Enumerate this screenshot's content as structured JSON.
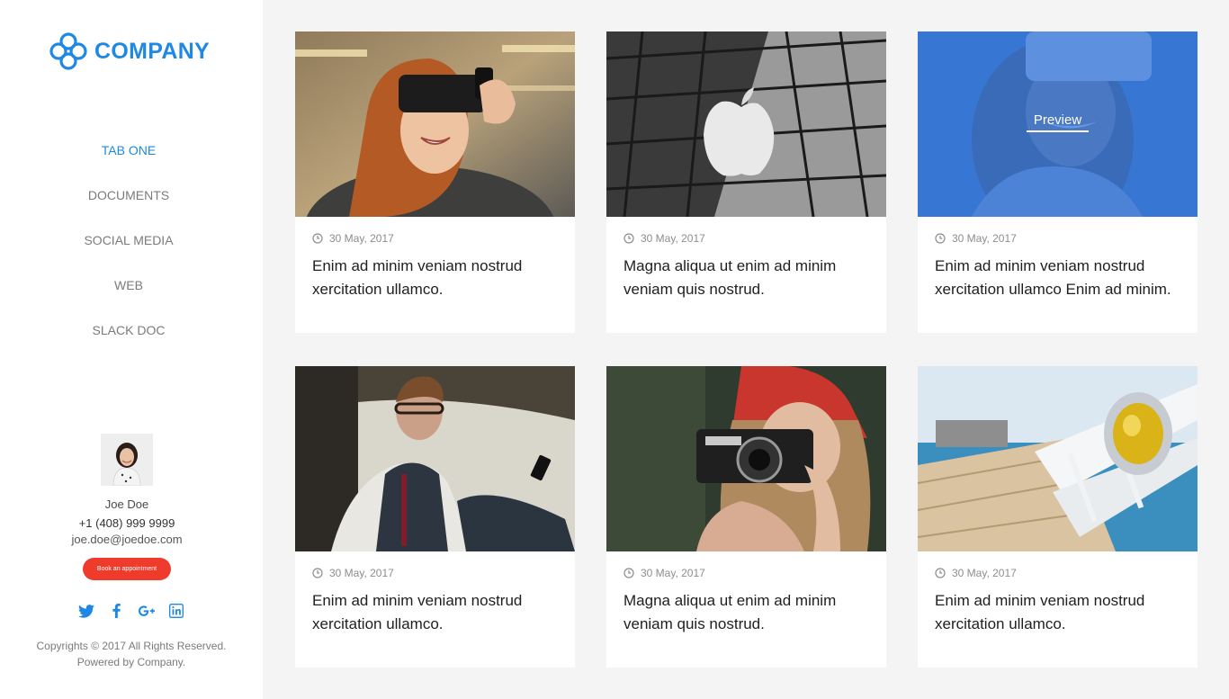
{
  "brand": {
    "name": "COMPANY",
    "color": "#1e88e5"
  },
  "nav": {
    "items": [
      {
        "label": "TAB ONE",
        "active": true
      },
      {
        "label": "DOCUMENTS",
        "active": false
      },
      {
        "label": "SOCIAL MEDIA",
        "active": false
      },
      {
        "label": "WEB",
        "active": false
      },
      {
        "label": "SLACK DOC",
        "active": false
      }
    ]
  },
  "profile": {
    "name": "Joe Doe",
    "phone": "+1 (408) 999 9999",
    "email": "joe.doe@joedoe.com",
    "button_label": "Book an appointment",
    "button_color": "#ef3b2c"
  },
  "social": [
    "twitter-icon",
    "facebook-icon",
    "google-plus-icon",
    "linkedin-icon"
  ],
  "footer": {
    "line1": "Copyrights © 2017 All Rights Reserved.",
    "line2": "Powered by Company."
  },
  "cards": [
    {
      "date": "30 May, 2017",
      "title": "Enim ad minim veniam nostrud xercitation ullamco.",
      "image": "woman-vr-headset"
    },
    {
      "date": "30 May, 2017",
      "title": "Magna aliqua ut enim ad minim veniam quis nostrud.",
      "image": "apple-store-glass"
    },
    {
      "date": "30 May, 2017",
      "title": "Enim ad minim veniam nostrud xercitation ullamco Enim ad minim.",
      "image": "woman-vr-blue",
      "overlay_label": "Preview"
    },
    {
      "date": "30 May, 2017",
      "title": "Enim ad minim veniam nostrud xercitation ullamco.",
      "image": "man-phone-couch"
    },
    {
      "date": "30 May, 2017",
      "title": "Magna aliqua ut enim  ad minim veniam quis nostrud.",
      "image": "woman-camera"
    },
    {
      "date": "30 May, 2017",
      "title": "Enim ad minim veniam nostrud xercitation ullamco.",
      "image": "pier-railing"
    }
  ]
}
